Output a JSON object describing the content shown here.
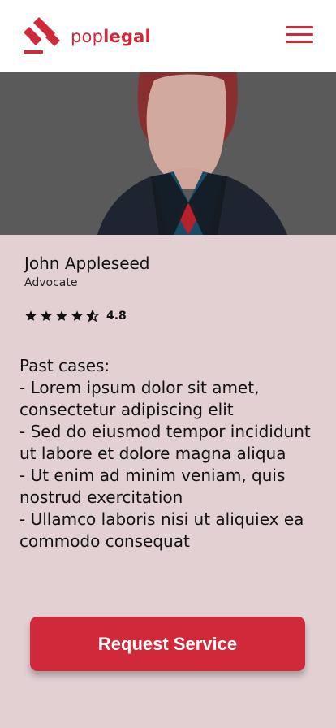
{
  "header": {
    "brand_prefix": "pop",
    "brand_suffix": "legal",
    "menu_icon": "menu-icon",
    "logo_icon": "gavel-logo-icon"
  },
  "hero": {
    "image_desc": ""
  },
  "lawyer": {
    "name": "John Appleseed",
    "role": "Advocate",
    "rating": "4.8",
    "rating_stars": 4.5
  },
  "cases": {
    "title": "Past cases:",
    "items": [
      "- Lorem ipsum dolor sit amet, consectetur adipiscing elit",
      "- Sed do eiusmod tempor incididunt ut labore et dolore magna aliqua",
      "- Ut enim ad minim veniam, quis nostrud exercitation",
      "- Ullamco laboris nisi ut aliquiex ea commodo consequat"
    ]
  },
  "cta": {
    "label": "Request Service"
  },
  "colors": {
    "brand_red": "#d0293a",
    "profile_bg": "#e2d0d3",
    "hero_bg": "#5a5a5a"
  }
}
